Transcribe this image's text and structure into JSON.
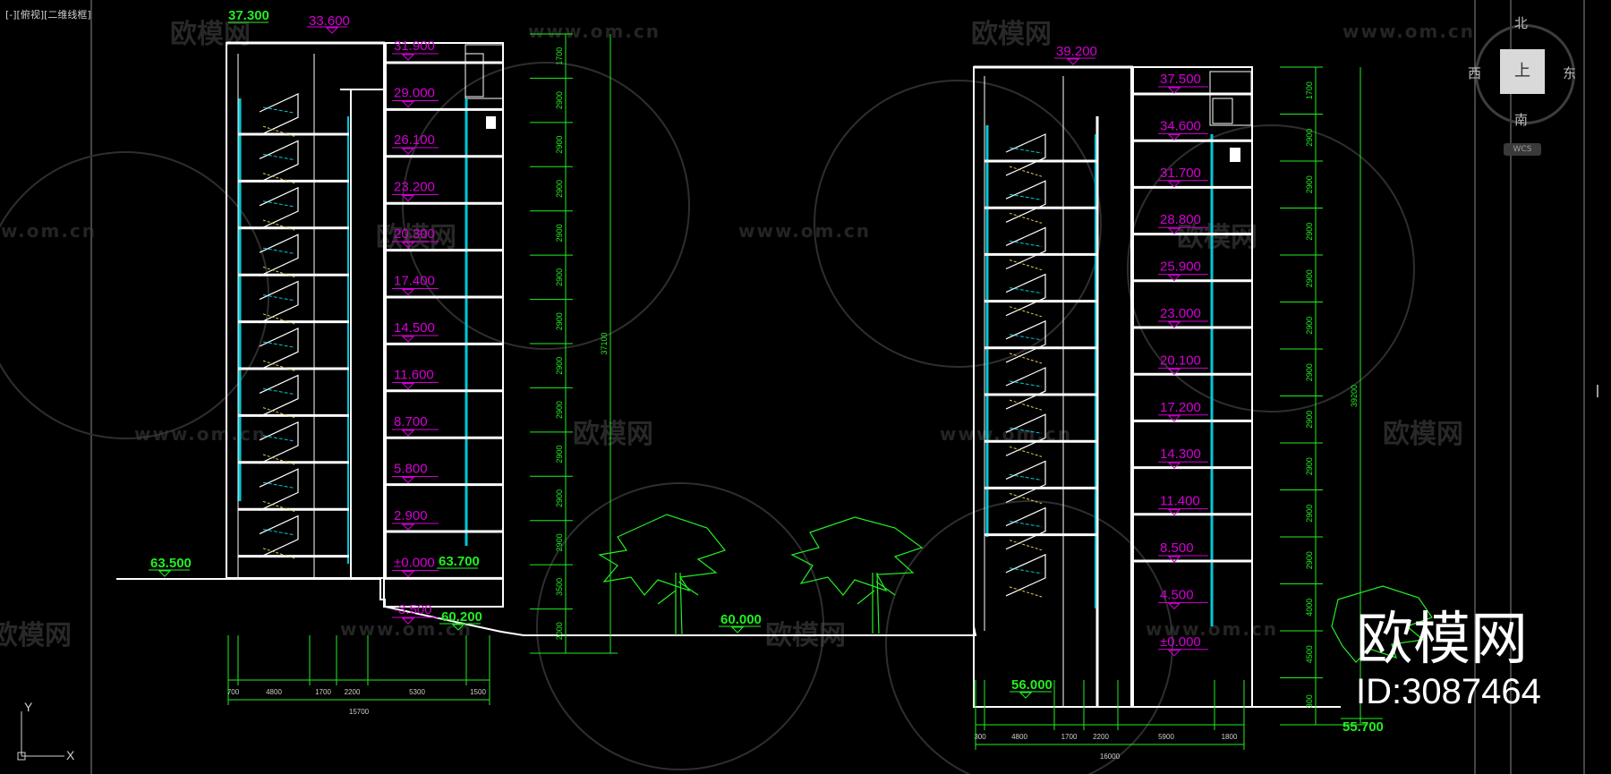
{
  "viewport": {
    "label": "[-][俯视][二维线框]"
  },
  "viewcube": {
    "north": "北",
    "south": "南",
    "west": "西",
    "east": "东",
    "face": "上",
    "wcs": "WCS"
  },
  "brand": {
    "name": "欧模网",
    "id": "ID:3087464"
  },
  "watermark": {
    "text": "欧模网",
    "url": "www.om.cn"
  },
  "ucs": {
    "x": "X",
    "y": "Y"
  },
  "building_left": {
    "roof_levels": [
      "37.300",
      "33.600"
    ],
    "levels": [
      "31.900",
      "29.000",
      "26.100",
      "23.200",
      "20.300",
      "17.400",
      "14.500",
      "11.600",
      "8.700",
      "5.800",
      "2.900",
      "±0.000",
      "-3.500"
    ],
    "ground_levels": [
      "63.500",
      "63.700",
      "60.200"
    ],
    "storey_dims": [
      "1700",
      "2900",
      "2900",
      "2900",
      "2900",
      "2900",
      "2900",
      "2900",
      "2900",
      "2900",
      "2900",
      "2900",
      "3500",
      "2000"
    ],
    "total_height": "37100",
    "bottom_dims": [
      "700",
      "4800",
      "1700",
      "2200",
      "5300",
      "1500"
    ],
    "total_width": "15700"
  },
  "site": {
    "ground_level": "60.000"
  },
  "building_right": {
    "roof_level": "39.200",
    "levels": [
      "37.500",
      "34.600",
      "31.700",
      "28.800",
      "25.900",
      "23.000",
      "20.100",
      "17.200",
      "14.300",
      "11.400",
      "8.500",
      "4.500",
      "±0.000"
    ],
    "ground_levels": [
      "56.000",
      "55.700"
    ],
    "storey_dims": [
      "1700",
      "2900",
      "2900",
      "2900",
      "2900",
      "2900",
      "2900",
      "2900",
      "2900",
      "2900",
      "2900",
      "4000",
      "4500",
      "300"
    ],
    "total_height": "39200",
    "bottom_dims": [
      "300",
      "4800",
      "1700",
      "2200",
      "5900",
      "1800"
    ],
    "total_width": "16000"
  }
}
